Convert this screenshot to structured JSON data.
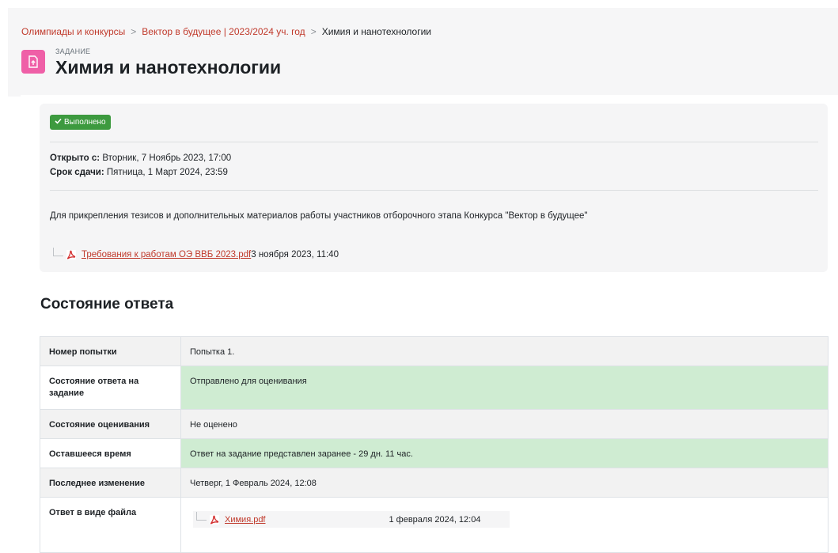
{
  "breadcrumb": {
    "items": [
      "Олимпиады и конкурсы",
      "Вектор в будущее | 2023/2024 уч. год"
    ],
    "current": "Химия и нанотехнологии"
  },
  "activity": {
    "type_label": "ЗАДАНИЕ",
    "title": "Химия и нанотехнологии",
    "icon": "assignment-upload-icon",
    "icon_color": "#ef5fa7"
  },
  "completion": {
    "label": "Выполнено",
    "color": "#3d9a3f"
  },
  "dates": {
    "opened_label": "Открыто с:",
    "opened_value": "Вторник, 7 Ноябрь 2023, 17:00",
    "due_label": "Срок сдачи:",
    "due_value": "Пятница, 1 Март 2024, 23:59"
  },
  "intro": "Для прикрепления тезисов и дополнительных материалов работы участников отборочного этапа Конкурса \"Вектор в будущее\"",
  "attachment": {
    "name": "Требования к работам ОЭ ВВБ 2023.pdf",
    "date": "3 ноября 2023, 11:40"
  },
  "submission": {
    "heading": "Состояние ответа",
    "rows": [
      {
        "label": "Номер попытки",
        "value": "Попытка 1."
      },
      {
        "label": "Состояние ответа на задание",
        "value": "Отправлено для оценивания"
      },
      {
        "label": "Состояние оценивания",
        "value": "Не оценено"
      },
      {
        "label": "Оставшееся время",
        "value": "Ответ на задание представлен заранее - 29 дн. 11 час."
      },
      {
        "label": "Последнее изменение",
        "value": "Четверг, 1 Февраль 2024, 12:08"
      },
      {
        "label": "Ответ в виде файла",
        "file_name": "Химия.pdf",
        "file_date": "1 февраля 2024, 12:04"
      }
    ],
    "highlight_color": "#cfecd2"
  },
  "colors": {
    "link": "#c0392b",
    "header_bg": "#f6f6f7"
  }
}
